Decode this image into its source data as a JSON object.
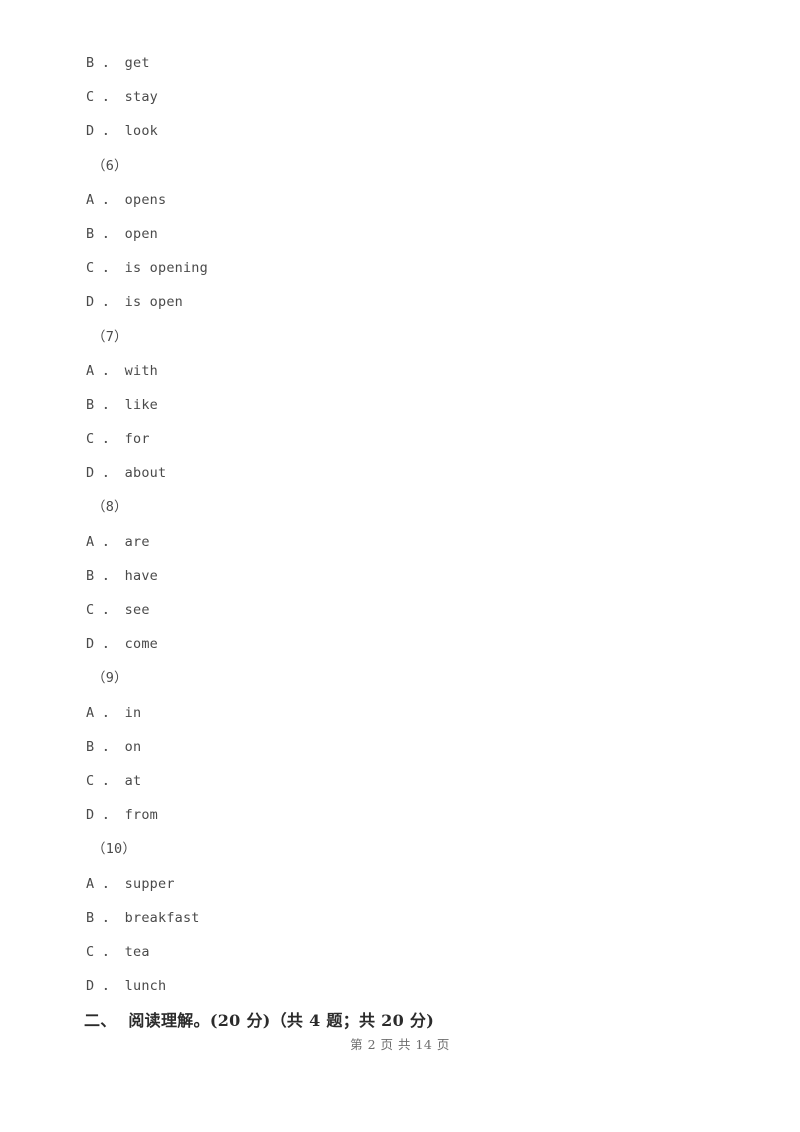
{
  "document": {
    "background_color": "#ffffff",
    "text_color": "#4a4a4a",
    "heading_color": "#2b2b2b",
    "footer_color": "#6d6d6d"
  },
  "lines": [
    {
      "kind": "option",
      "text": "B ． get"
    },
    {
      "kind": "option",
      "text": "C ． stay"
    },
    {
      "kind": "option",
      "text": "D ． look"
    },
    {
      "kind": "question",
      "text": "（6）"
    },
    {
      "kind": "option",
      "text": "A ． opens"
    },
    {
      "kind": "option",
      "text": "B ． open"
    },
    {
      "kind": "option",
      "text": "C ． is opening"
    },
    {
      "kind": "option",
      "text": "D ． is open"
    },
    {
      "kind": "question",
      "text": "（7）"
    },
    {
      "kind": "option",
      "text": "A ． with"
    },
    {
      "kind": "option",
      "text": "B ． like"
    },
    {
      "kind": "option",
      "text": "C ． for"
    },
    {
      "kind": "option",
      "text": "D ． about"
    },
    {
      "kind": "question",
      "text": "（8）"
    },
    {
      "kind": "option",
      "text": "A ． are"
    },
    {
      "kind": "option",
      "text": "B ． have"
    },
    {
      "kind": "option",
      "text": "C ． see"
    },
    {
      "kind": "option",
      "text": "D ． come"
    },
    {
      "kind": "question",
      "text": "（9）"
    },
    {
      "kind": "option",
      "text": "A ． in"
    },
    {
      "kind": "option",
      "text": "B ． on"
    },
    {
      "kind": "option",
      "text": "C ． at"
    },
    {
      "kind": "option",
      "text": "D ． from"
    },
    {
      "kind": "question",
      "text": "（10）"
    },
    {
      "kind": "option",
      "text": "A ． supper"
    },
    {
      "kind": "option",
      "text": "B ． breakfast"
    },
    {
      "kind": "option",
      "text": "C ． tea"
    },
    {
      "kind": "option",
      "text": "D ． lunch"
    }
  ],
  "section_heading": {
    "text": "二、  阅读理解。(20 分)（共 4 题；共 20 分)"
  },
  "footer": {
    "text": "第 2 页 共 14 页",
    "current_page": "2",
    "total_pages": "14"
  }
}
